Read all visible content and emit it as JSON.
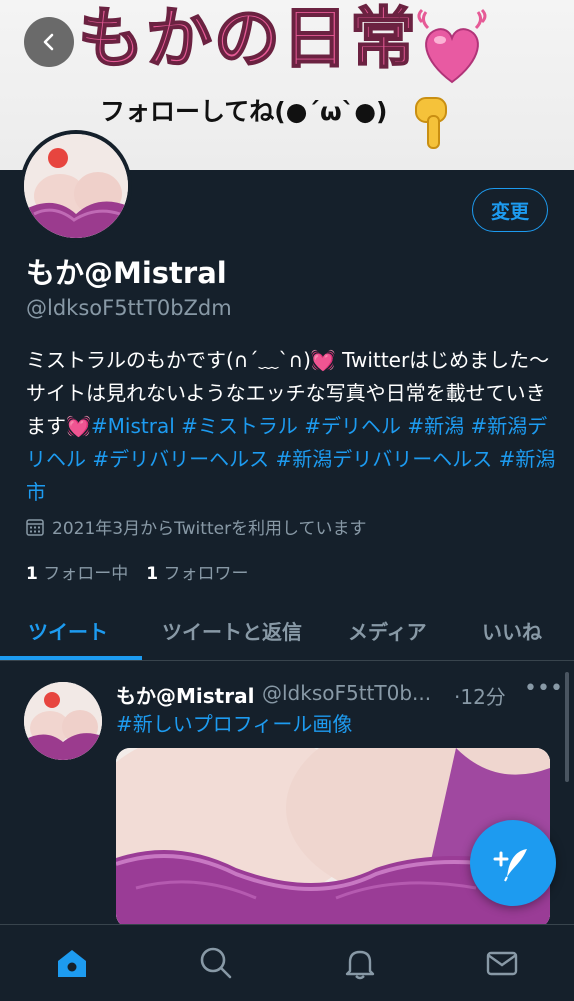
{
  "banner": {
    "title": "もかの日常",
    "subtitle": "フォローしてね(●´ω`●)"
  },
  "header": {
    "back_icon": "chevron-left-icon",
    "edit_label": "変更"
  },
  "profile": {
    "display_name": "もか@Mistral",
    "handle": "@ldksoF5ttT0bZdm",
    "bio": {
      "p1": "ミストラルのもかです(∩´﹏`∩)",
      "p2": " Twitterはじめました〜 サイトは見れないようなエッチな写真や日常を載せていきます",
      "emoji": "💓",
      "tags": [
        "#Mistral",
        "#ミストラル",
        "#デリヘル",
        "#新潟",
        "#新潟デリヘル",
        "#デリバリーヘルス",
        "#新潟デリバリーヘルス",
        "#新潟市"
      ]
    },
    "joined": "2021年3月からTwitterを利用しています",
    "following_count": "1",
    "following_label": "フォロー中",
    "followers_count": "1",
    "followers_label": "フォロワー"
  },
  "tabs": [
    {
      "label": "ツイート",
      "active": true
    },
    {
      "label": "ツイートと返信",
      "active": false
    },
    {
      "label": "メディア",
      "active": false
    },
    {
      "label": "いいね",
      "active": false
    }
  ],
  "tweet": {
    "name": "もか@Mistral",
    "handle": "@ldksoF5ttT0b...",
    "time": "·12分",
    "more": "•••",
    "text": "#新しいプロフィール画像"
  },
  "bottom_nav": [
    "home-icon",
    "search-icon",
    "bell-icon",
    "mail-icon"
  ],
  "colors": {
    "background": "#15202b",
    "accent": "#1d9bf0",
    "muted": "#8899a6",
    "banner_title": "#e65a96"
  }
}
